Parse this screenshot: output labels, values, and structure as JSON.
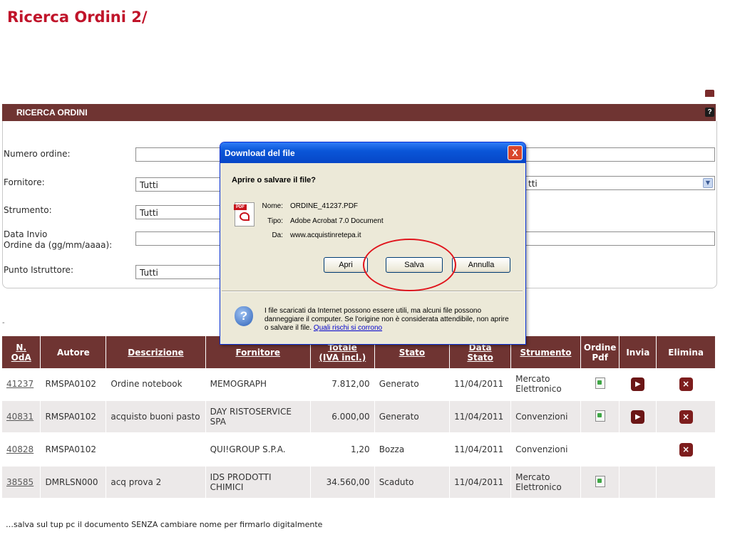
{
  "slide_title": "Ricerca Ordini 2/",
  "panel": {
    "title": "RICERCA ORDINI",
    "help": "?"
  },
  "form": {
    "numero_ordine": {
      "label": "Numero ordine:",
      "value": ""
    },
    "fornitore": {
      "label": "Fornitore:",
      "value": "Tutti"
    },
    "strumento": {
      "label": "Strumento:",
      "value": "Tutti"
    },
    "data_invio": {
      "label_line1": "Data Invio",
      "label_line2": "Ordine da (gg/mm/aaaa):",
      "value": ""
    },
    "punto_istruttore": {
      "label": "Punto Istruttore:",
      "value": "Tutti"
    },
    "right_select_value": "tti"
  },
  "dash": "-",
  "table": {
    "headers": {
      "n_oda_1": "N.",
      "n_oda_2": "OdA",
      "autore": "Autore",
      "descrizione": "Descrizione",
      "fornitore": "Fornitore",
      "totale_1": "Totale",
      "totale_2": "(IVA incl.)",
      "stato": "Stato",
      "data_stato_1": "Data",
      "data_stato_2": "Stato",
      "strumento": "Strumento",
      "ordine_pdf_1": "Ordine",
      "ordine_pdf_2": "Pdf",
      "invia": "Invia",
      "elimina": "Elimina"
    },
    "rows": [
      {
        "n": "41237",
        "autore": "RMSPA0102",
        "descrizione": "Ordine notebook",
        "fornitore": "MEMOGRAPH",
        "totale": "7.812,00",
        "stato": "Generato",
        "data": "11/04/2011",
        "strumento": "Mercato Elettronico"
      },
      {
        "n": "40831",
        "autore": "RMSPA0102",
        "descrizione": "acquisto buoni pasto",
        "fornitore": "DAY RISTOSERVICE SPA",
        "totale": "6.000,00",
        "stato": "Generato",
        "data": "11/04/2011",
        "strumento": "Convenzioni"
      },
      {
        "n": "40828",
        "autore": "RMSPA0102",
        "descrizione": "",
        "fornitore": "QUI!GROUP S.P.A.",
        "totale": "1,20",
        "stato": "Bozza",
        "data": "11/04/2011",
        "strumento": "Convenzioni"
      },
      {
        "n": "38585",
        "autore": "DMRLSN000",
        "descrizione": "acq prova 2",
        "fornitore": "IDS PRODOTTI CHIMICI",
        "totale": "34.560,00",
        "stato": "Scaduto",
        "data": "11/04/2011",
        "strumento": "Mercato Elettronico"
      }
    ]
  },
  "dialog": {
    "title": "Download del file",
    "question": "Aprire o salvare il file?",
    "nome_label": "Nome:",
    "nome_value": "ORDINE_41237.PDF",
    "tipo_label": "Tipo:",
    "tipo_value": "Adobe Acrobat 7.0 Document",
    "da_label": "Da:",
    "da_value": "www.acquistinretepa.it",
    "btn_apri": "Apri",
    "btn_salva": "Salva",
    "btn_annulla": "Annulla",
    "warning": "I file scaricati da Internet possono essere utili, ma alcuni file possono danneggiare il computer. Se l'origine non è considerata attendibile, non aprire o salvare il file.",
    "warning_link": "Quali rischi si corrono",
    "pdf_badge": "PDF",
    "shield_glyph": "?",
    "close_glyph": "X"
  },
  "caption": "…salva sul tup pc il documento SENZA cambiare nome per firmarlo digitalmente",
  "colors": {
    "header_brown": "#6f3432",
    "title_red": "#c0142a",
    "xp_blue": "#0a56d8",
    "highlight_red": "#e0141c"
  }
}
